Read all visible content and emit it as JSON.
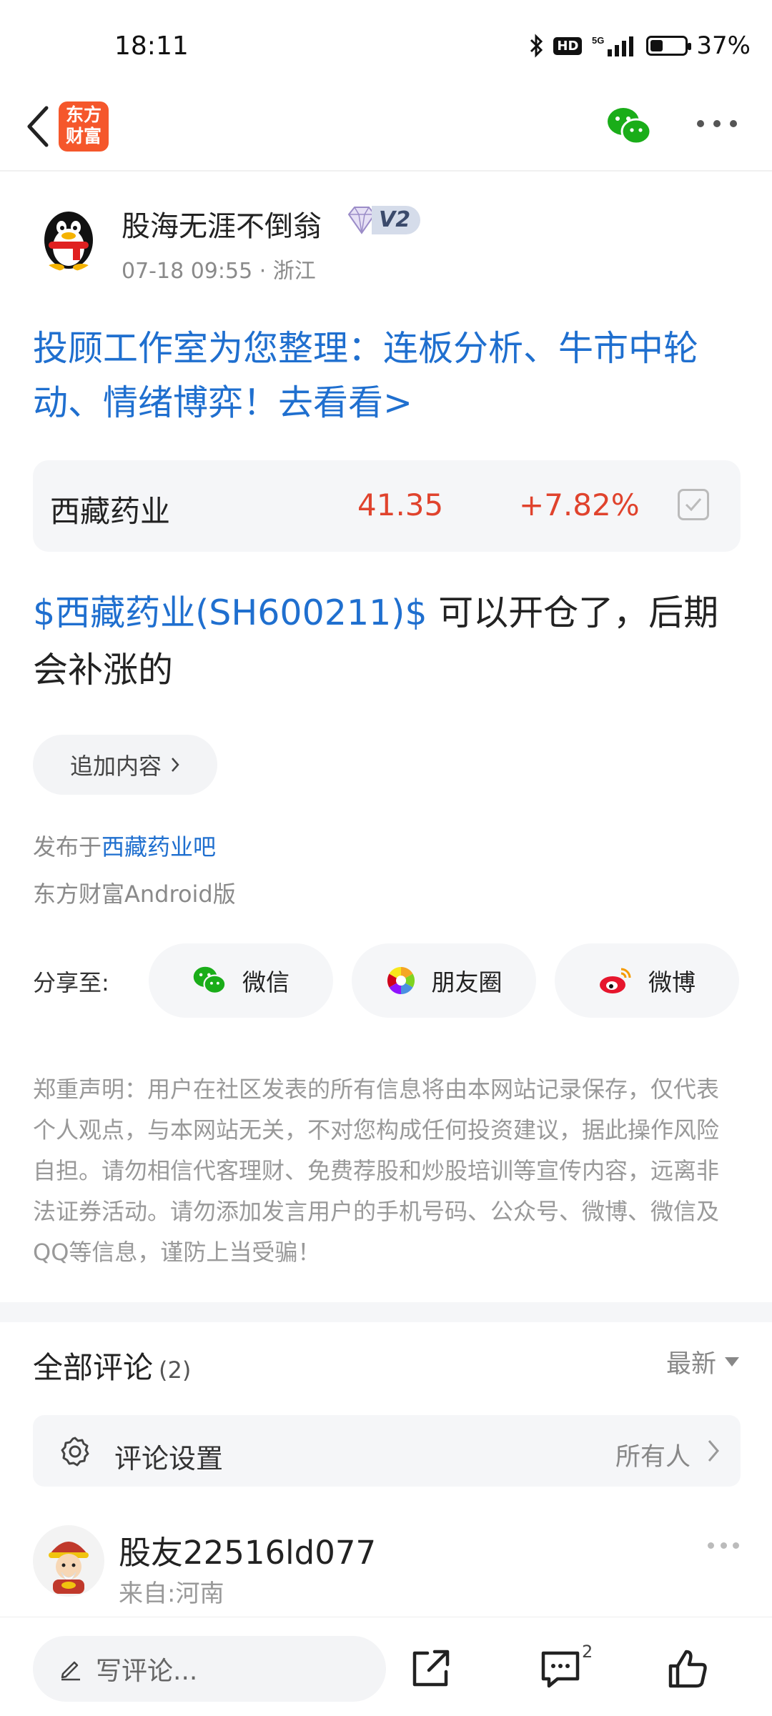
{
  "status_bar": {
    "time": "18:11",
    "battery_percent": "37%",
    "battery_level": 0.37,
    "icons": [
      "bluetooth-icon",
      "hd-icon",
      "5g-signal-icon",
      "battery-icon"
    ]
  },
  "header": {
    "logo_text_line1": "东方",
    "logo_text_line2": "财富",
    "brand_color": "#f5572b"
  },
  "post": {
    "author": "股海无涯不倒翁",
    "level_badge": "V2",
    "timestamp": "07-18 09:55",
    "location": "浙江",
    "promo": "投顾工作室为您整理：连板分析、牛市中轮动、情绪博弈！去看看>",
    "stock": {
      "name": "西藏药业",
      "price": "41.35",
      "change": "+7.82%",
      "up_color": "#e0432d"
    },
    "body_link": "$西藏药业(SH600211)$",
    "body_text": " 可以开仓了，后期会补涨的",
    "add_content_label": "追加内容",
    "posted_prefix": "发布于",
    "posted_bar": "西藏药业吧",
    "client": "东方财富Android版"
  },
  "share": {
    "label": "分享至:",
    "items": [
      {
        "label": "微信",
        "icon": "wechat-icon"
      },
      {
        "label": "朋友圈",
        "icon": "moments-icon"
      },
      {
        "label": "微博",
        "icon": "weibo-icon"
      }
    ]
  },
  "disclaimer": "郑重声明：用户在社区发表的所有信息将由本网站记录保存，仅代表个人观点，与本网站无关，不对您构成任何投资建议，据此操作风险自担。请勿相信代客理财、免费荐股和炒股培训等宣传内容，远离非法证券活动。请勿添加发言用户的手机号码、公众号、微博、微信及QQ等信息，谨防上当受骗！",
  "comments": {
    "title": "全部评论",
    "count": "(2)",
    "sort": "最新",
    "settings_label": "评论设置",
    "settings_value": "所有人",
    "items": [
      {
        "user": "股友22516ld077",
        "from": "来自:河南"
      }
    ]
  },
  "bottom_bar": {
    "write_placeholder": "写评论...",
    "comment_badge": "2"
  },
  "link_color": "#1f6fcf"
}
